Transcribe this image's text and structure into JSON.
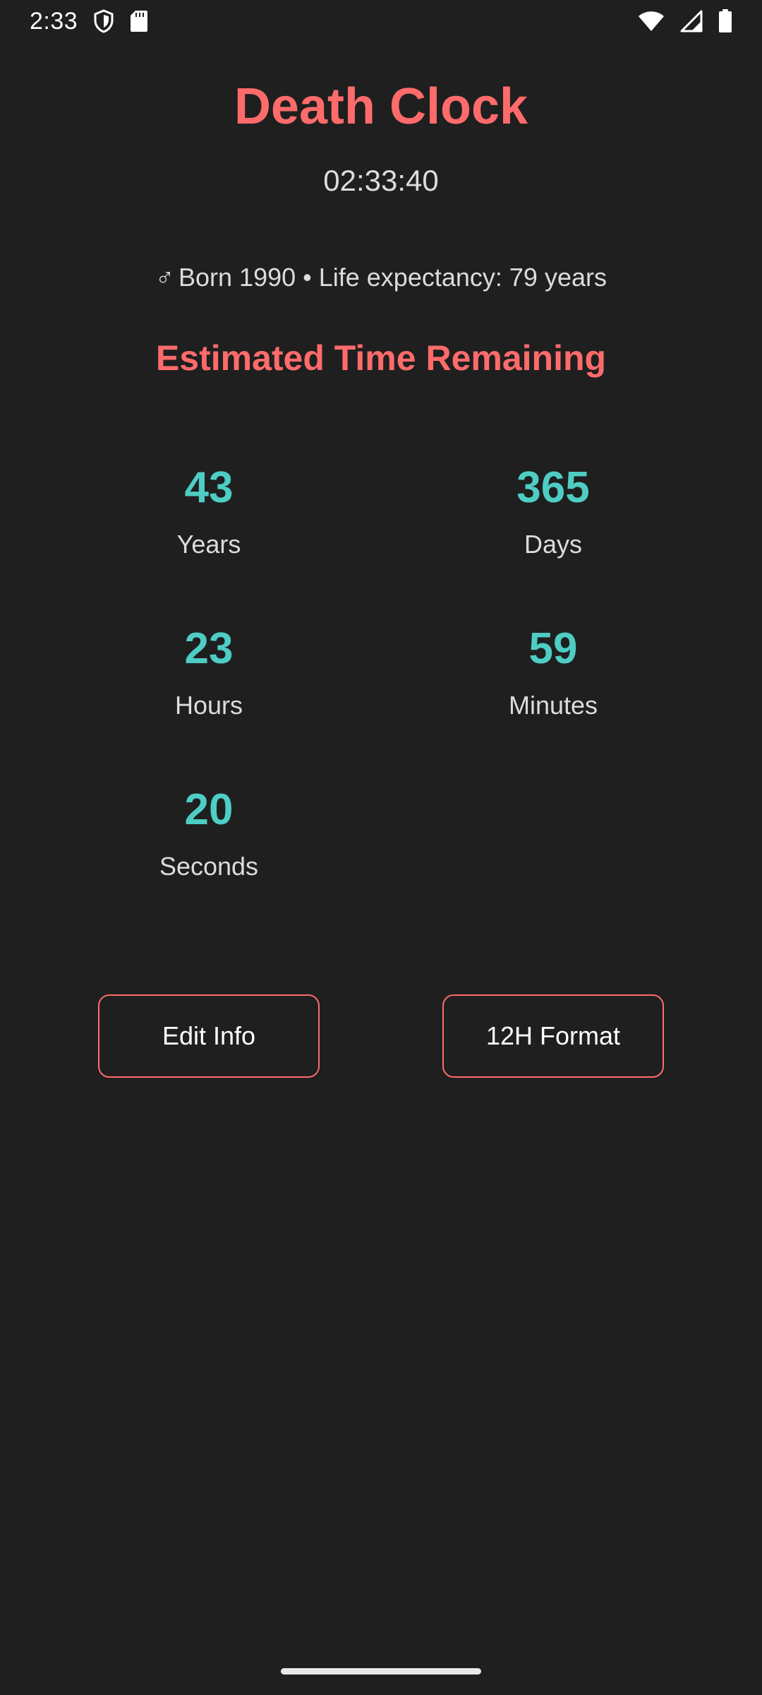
{
  "status_bar": {
    "time": "2:33",
    "left_icons": [
      "shield-icon",
      "sd-card-icon"
    ],
    "right_icons": [
      "wifi-icon",
      "cell-signal-icon",
      "battery-icon"
    ]
  },
  "app": {
    "title": "Death Clock",
    "clock": "02:33:40",
    "info": {
      "gender_symbol": "♂",
      "text": "Born 1990 • Life expectancy: 79 years"
    },
    "subtitle": "Estimated Time Remaining",
    "countdown": {
      "years": {
        "value": "43",
        "label": "Years"
      },
      "days": {
        "value": "365",
        "label": "Days"
      },
      "hours": {
        "value": "23",
        "label": "Hours"
      },
      "minutes": {
        "value": "59",
        "label": "Minutes"
      },
      "seconds": {
        "value": "20",
        "label": "Seconds"
      }
    },
    "buttons": {
      "edit_info": "Edit Info",
      "format_toggle": "12H Format"
    }
  },
  "colors": {
    "background": "#1f1f1f",
    "accent": "#ff6b6b",
    "value": "#4ecdc4",
    "text_secondary": "#dcdcdc"
  }
}
